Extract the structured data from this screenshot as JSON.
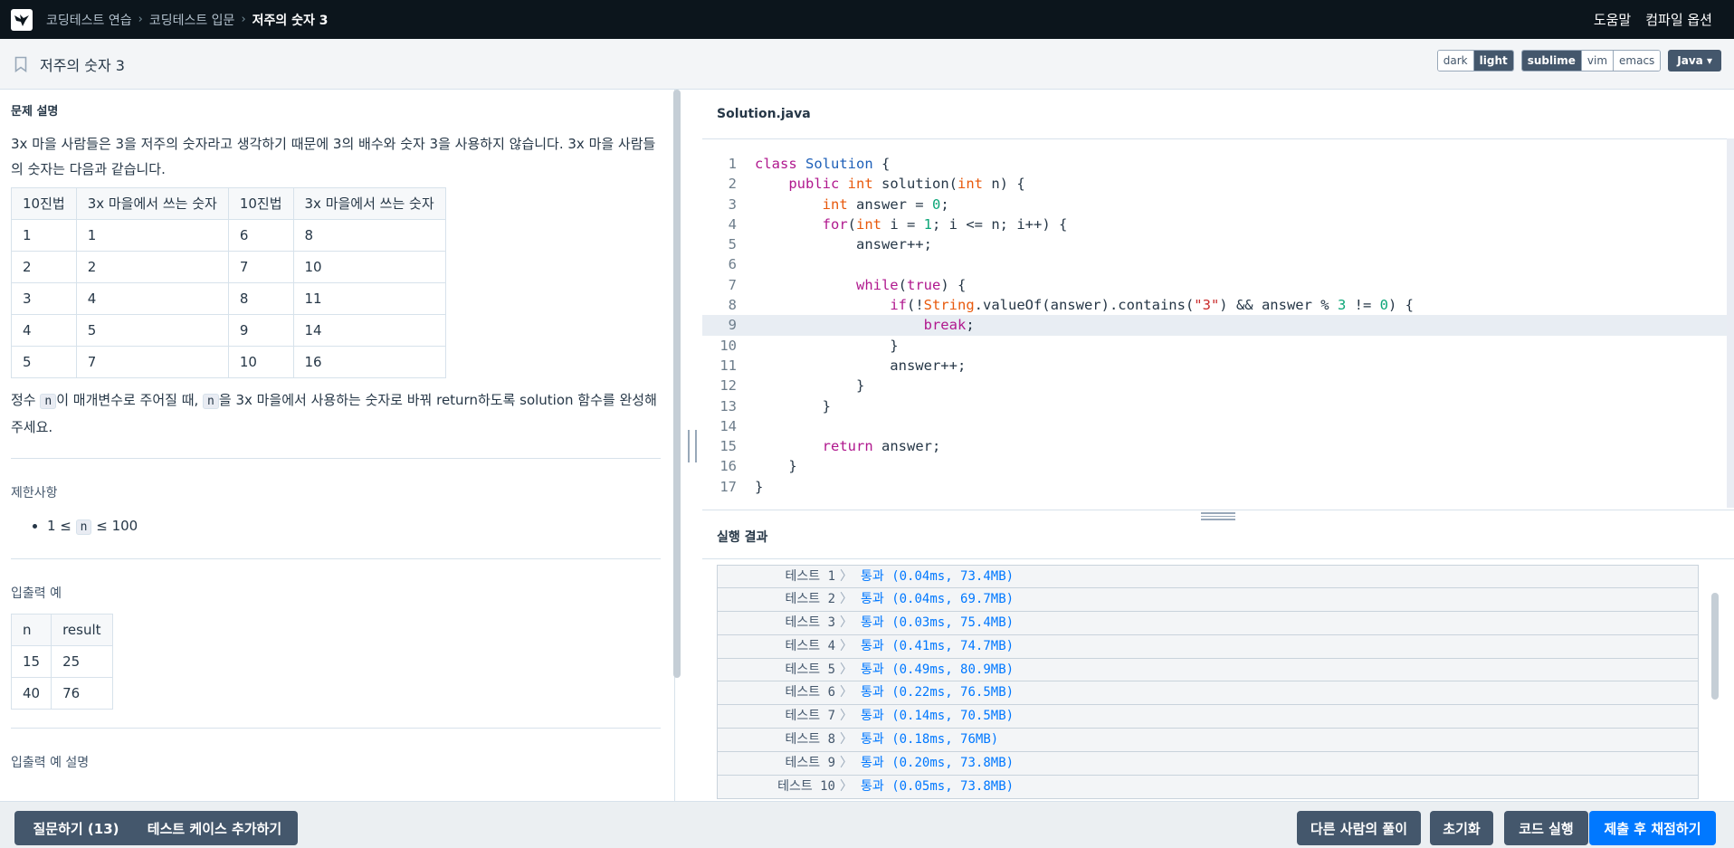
{
  "topnav": {
    "breadcrumbs": [
      "코딩테스트 연습",
      "코딩테스트 입문"
    ],
    "current": "저주의 숫자 3",
    "help": "도움말",
    "compile_options": "컴파일 옵션"
  },
  "header": {
    "title": "저주의 숫자 3",
    "theme_options": [
      "dark",
      "light"
    ],
    "theme_selected": "light",
    "keymap_options": [
      "sublime",
      "vim",
      "emacs"
    ],
    "keymap_selected": "sublime",
    "language": "Java"
  },
  "description": {
    "heading": "문제 설명",
    "intro": "3x 마을 사람들은 3을 저주의 숫자라고 생각하기 때문에 3의 배수와 숫자 3을 사용하지 않습니다. 3x 마을 사람들의 숫자는 다음과 같습니다.",
    "table_headers": [
      "10진법",
      "3x 마을에서 쓰는 숫자",
      "10진법",
      "3x 마을에서 쓰는 숫자"
    ],
    "table_rows": [
      [
        "1",
        "1",
        "6",
        "8"
      ],
      [
        "2",
        "2",
        "7",
        "10"
      ],
      [
        "3",
        "4",
        "8",
        "11"
      ],
      [
        "4",
        "5",
        "9",
        "14"
      ],
      [
        "5",
        "7",
        "10",
        "16"
      ]
    ],
    "task_pre": "정수 ",
    "task_var": "n",
    "task_mid": "이 매개변수로 주어질 때, ",
    "task_var2": "n",
    "task_post": "을 3x 마을에서 사용하는 숫자로 바꿔 return하도록 solution 함수를 완성해주세요.",
    "limits_heading": "제한사항",
    "limit_pre": "1 ≤ ",
    "limit_var": "n",
    "limit_post": " ≤ 100",
    "io_heading": "입출력 예",
    "io_headers": [
      "n",
      "result"
    ],
    "io_rows": [
      [
        "15",
        "25"
      ],
      [
        "40",
        "76"
      ]
    ],
    "io_desc_heading": "입출력 예 설명"
  },
  "editor": {
    "filename": "Solution.java",
    "active_line": 9,
    "line_numbers": [
      "1",
      "2",
      "3",
      "4",
      "5",
      "6",
      "7",
      "8",
      "9",
      "10",
      "11",
      "12",
      "13",
      "14",
      "15",
      "16",
      "17"
    ]
  },
  "results": {
    "heading": "실행 결과",
    "rows": [
      {
        "name": "테스트 1",
        "result": "통과 (0.04ms, 73.4MB)"
      },
      {
        "name": "테스트 2",
        "result": "통과 (0.04ms, 69.7MB)"
      },
      {
        "name": "테스트 3",
        "result": "통과 (0.03ms, 75.4MB)"
      },
      {
        "name": "테스트 4",
        "result": "통과 (0.41ms, 74.7MB)"
      },
      {
        "name": "테스트 5",
        "result": "통과 (0.49ms, 80.9MB)"
      },
      {
        "name": "테스트 6",
        "result": "통과 (0.22ms, 76.5MB)"
      },
      {
        "name": "테스트 7",
        "result": "통과 (0.14ms, 70.5MB)"
      },
      {
        "name": "테스트 8",
        "result": "통과 (0.18ms, 76MB)"
      },
      {
        "name": "테스트 9",
        "result": "통과 (0.20ms, 73.8MB)"
      },
      {
        "name": "테스트 10",
        "result": "통과 (0.05ms, 73.8MB)"
      }
    ]
  },
  "bottom": {
    "ask": "질문하기 (13)",
    "add_test": "테스트 케이스 추가하기",
    "others": "다른 사람의 풀이",
    "reset": "초기화",
    "run": "코드 실행",
    "submit": "제출 후 채점하기"
  },
  "colors": {
    "nav_bg": "#0c151c",
    "accent": "#0078ff",
    "button": "#44576c",
    "keyword": "#b0188e",
    "type": "#e8590c"
  }
}
